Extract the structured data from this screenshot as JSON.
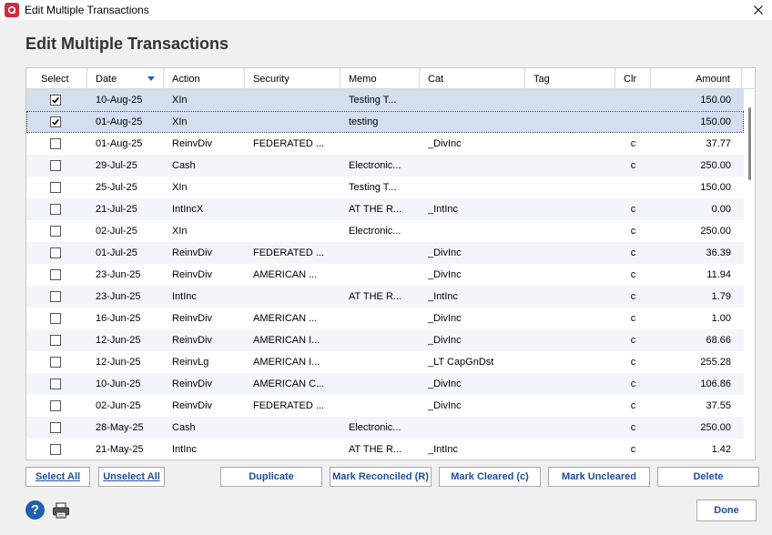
{
  "window": {
    "title": "Edit Multiple Transactions"
  },
  "heading": "Edit Multiple Transactions",
  "columns": {
    "select": "Select",
    "date": "Date",
    "action": "Action",
    "security": "Security",
    "memo": "Memo",
    "cat": "Cat",
    "tag": "Tag",
    "clr": "Clr",
    "amount": "Amount"
  },
  "rows": [
    {
      "checked": true,
      "date": "10-Aug-25",
      "action": "XIn",
      "security": "",
      "memo": "Testing T...",
      "cat": "",
      "tag": "",
      "clr": "",
      "amount": "150.00"
    },
    {
      "checked": true,
      "date": "01-Aug-25",
      "action": "XIn",
      "security": "",
      "memo": "testing",
      "cat": "",
      "tag": "",
      "clr": "",
      "amount": "150.00"
    },
    {
      "checked": false,
      "date": "01-Aug-25",
      "action": "ReinvDiv",
      "security": "FEDERATED ...",
      "memo": "",
      "cat": "_DivInc",
      "tag": "",
      "clr": "c",
      "amount": "37.77"
    },
    {
      "checked": false,
      "date": "29-Jul-25",
      "action": "Cash",
      "security": "",
      "memo": "Electronic...",
      "cat": "",
      "tag": "",
      "clr": "c",
      "amount": "250.00"
    },
    {
      "checked": false,
      "date": "25-Jul-25",
      "action": "XIn",
      "security": "",
      "memo": "Testing T...",
      "cat": "",
      "tag": "",
      "clr": "",
      "amount": "150.00"
    },
    {
      "checked": false,
      "date": "21-Jul-25",
      "action": "IntIncX",
      "security": "",
      "memo": "AT THE R...",
      "cat": "_IntInc",
      "tag": "",
      "clr": "c",
      "amount": "0.00"
    },
    {
      "checked": false,
      "date": "02-Jul-25",
      "action": "XIn",
      "security": "",
      "memo": "Electronic...",
      "cat": "",
      "tag": "",
      "clr": "c",
      "amount": "250.00"
    },
    {
      "checked": false,
      "date": "01-Jul-25",
      "action": "ReinvDiv",
      "security": "FEDERATED ...",
      "memo": "",
      "cat": "_DivInc",
      "tag": "",
      "clr": "c",
      "amount": "36.39"
    },
    {
      "checked": false,
      "date": "23-Jun-25",
      "action": "ReinvDiv",
      "security": "AMERICAN ...",
      "memo": "",
      "cat": "_DivInc",
      "tag": "",
      "clr": "c",
      "amount": "11.94"
    },
    {
      "checked": false,
      "date": "23-Jun-25",
      "action": "IntInc",
      "security": "",
      "memo": "AT THE R...",
      "cat": "_IntInc",
      "tag": "",
      "clr": "c",
      "amount": "1.79"
    },
    {
      "checked": false,
      "date": "16-Jun-25",
      "action": "ReinvDiv",
      "security": "AMERICAN ...",
      "memo": "",
      "cat": "_DivInc",
      "tag": "",
      "clr": "c",
      "amount": "1.00"
    },
    {
      "checked": false,
      "date": "12-Jun-25",
      "action": "ReinvDiv",
      "security": "AMERICAN I...",
      "memo": "",
      "cat": "_DivInc",
      "tag": "",
      "clr": "c",
      "amount": "68.66"
    },
    {
      "checked": false,
      "date": "12-Jun-25",
      "action": "ReinvLg",
      "security": "AMERICAN I...",
      "memo": "",
      "cat": "_LT CapGnDst",
      "tag": "",
      "clr": "c",
      "amount": "255.28"
    },
    {
      "checked": false,
      "date": "10-Jun-25",
      "action": "ReinvDiv",
      "security": "AMERICAN C...",
      "memo": "",
      "cat": "_DivInc",
      "tag": "",
      "clr": "c",
      "amount": "106.86"
    },
    {
      "checked": false,
      "date": "02-Jun-25",
      "action": "ReinvDiv",
      "security": "FEDERATED ...",
      "memo": "",
      "cat": "_DivInc",
      "tag": "",
      "clr": "c",
      "amount": "37.55"
    },
    {
      "checked": false,
      "date": "28-May-25",
      "action": "Cash",
      "security": "",
      "memo": "Electronic...",
      "cat": "",
      "tag": "",
      "clr": "c",
      "amount": "250.00"
    },
    {
      "checked": false,
      "date": "21-May-25",
      "action": "IntInc",
      "security": "",
      "memo": "AT THE R...",
      "cat": "_IntInc",
      "tag": "",
      "clr": "c",
      "amount": "1.42"
    }
  ],
  "buttons": {
    "select_all": "Select All",
    "unselect_all": "Unselect All",
    "duplicate": "Duplicate",
    "mark_reconciled": "Mark Reconciled (R)",
    "mark_cleared": "Mark Cleared (c)",
    "mark_uncleared": "Mark Uncleared",
    "delete": "Delete",
    "done": "Done"
  },
  "help": {
    "glyph": "?"
  },
  "colors": {
    "selected_row": "#d3deef",
    "alt_row": "#f2f6fb",
    "button_text": "#1f4fa0",
    "app_icon": "#d5283b"
  }
}
